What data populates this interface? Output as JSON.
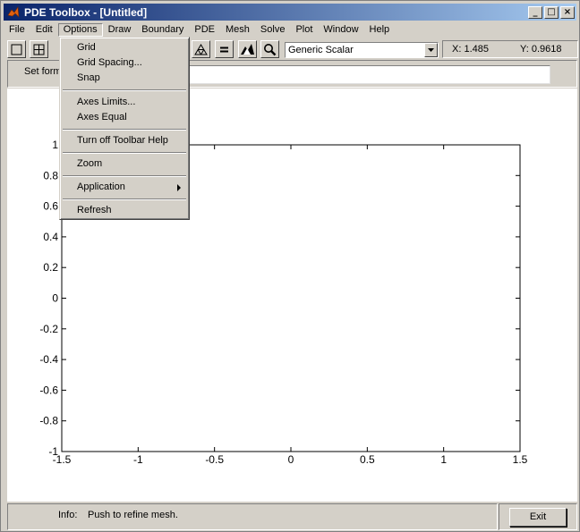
{
  "window": {
    "title": "PDE Toolbox - [Untitled]",
    "minimize_glyph": "_",
    "maximize_glyph": "□",
    "close_glyph": "×"
  },
  "menubar": {
    "items": [
      "File",
      "Edit",
      "Options",
      "Draw",
      "Boundary",
      "PDE",
      "Mesh",
      "Solve",
      "Plot",
      "Window",
      "Help"
    ],
    "open_item": "Options"
  },
  "options_menu": {
    "grid": "Grid",
    "grid_spacing": "Grid Spacing...",
    "snap": "Snap",
    "axes_limits": "Axes Limits...",
    "axes_equal": "Axes Equal",
    "turn_off_toolbar_help": "Turn off Toolbar Help",
    "zoom": "Zoom",
    "application": "Application",
    "refresh": "Refresh"
  },
  "toolbar": {
    "icons": [
      "rectangle-icon",
      "centered-rectangle-icon",
      "triangle-mesh-icon",
      "equals-icon",
      "pde-plot-icon",
      "zoom-icon"
    ],
    "application_select": "Generic Scalar",
    "coord_x": "X: 1.485",
    "coord_y": "Y: 0.9618"
  },
  "formula": {
    "label": "Set form",
    "value": ""
  },
  "axes": {
    "x_ticks": [
      "-1.5",
      "-1",
      "-0.5",
      "0",
      "0.5",
      "1",
      "1.5"
    ],
    "y_ticks": [
      "1",
      "0.8",
      "0.6",
      "0.4",
      "0.2",
      "0",
      "-0.2",
      "-0.4",
      "-0.6",
      "-0.8",
      "-1"
    ],
    "xlim": [
      -1.5,
      1.5
    ],
    "ylim": [
      -1,
      1
    ]
  },
  "status": {
    "info_label": "Info:",
    "info_text": "Push to refine mesh.",
    "exit_label": "Exit"
  },
  "colors": {
    "title_active": "#0a246a",
    "face": "#d4d0c8",
    "logo": "#e06010"
  }
}
